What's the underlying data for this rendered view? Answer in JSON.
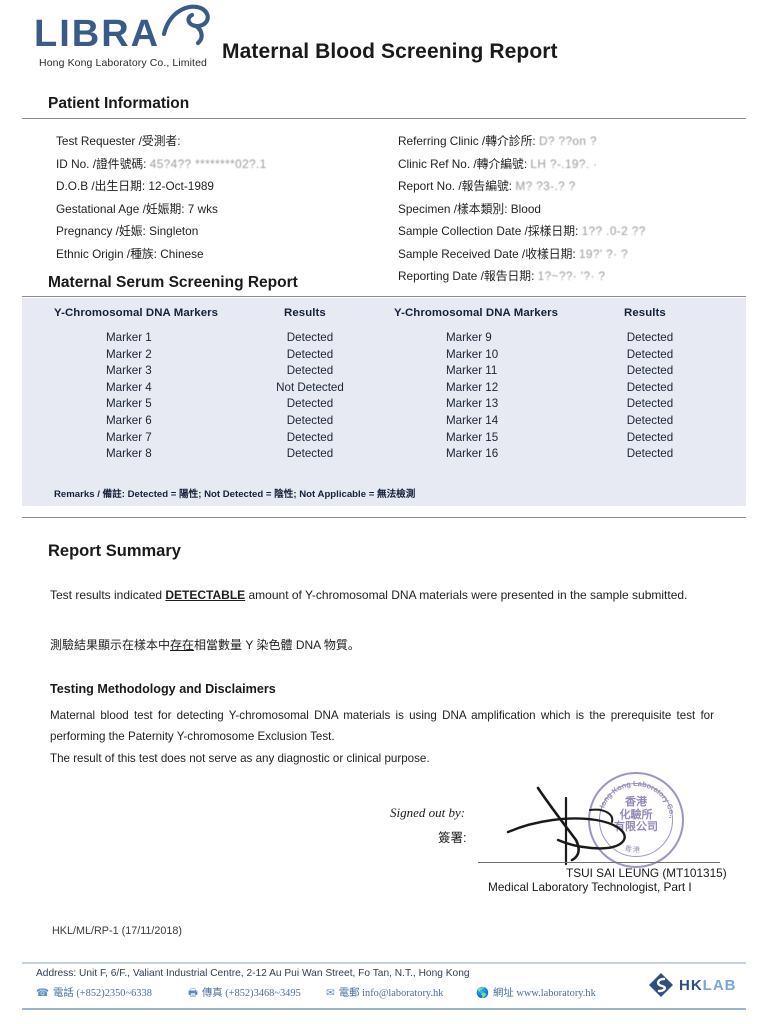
{
  "header": {
    "logo_word": "LIBRA",
    "logo_sub": "Hong Kong Laboratory Co., Limited",
    "title": "Maternal Blood Screening Report"
  },
  "patient_section": {
    "heading": "Patient Information",
    "left_fields": [
      {
        "label": "Test Requester /受測者:",
        "value": "",
        "faded": true
      },
      {
        "label": "ID No. /證件號碼:",
        "value": "45?4?? ********02?.1",
        "faded": true
      },
      {
        "label": "D.O.B /出生日期:",
        "value": "12-Oct-1989",
        "faded": false
      },
      {
        "label": "Gestational Age /妊娠期:",
        "value": "7 wks",
        "faded": false
      },
      {
        "label": "Pregnancy /妊娠:",
        "value": "Singleton",
        "faded": false
      },
      {
        "label": "Ethnic Origin /種族:",
        "value": "Chinese",
        "faded": false
      }
    ],
    "right_fields": [
      {
        "label": "Referring Clinic /轉介診所:",
        "value": "D? ??on  ?",
        "faded": true
      },
      {
        "label": "Clinic Ref No. /轉介編號:",
        "value": "LH  ?-.19?. ·",
        "faded": true
      },
      {
        "label": "Report No. /報告編號:",
        "value": "M? ?3-.?  ?",
        "faded": true
      },
      {
        "label": "Specimen /樣本類別:",
        "value": "Blood",
        "faded": false
      },
      {
        "label": "Sample Collection Date /採樣日期:",
        "value": "1?? .0-2 ??",
        "faded": true
      },
      {
        "label": "Sample Received Date /收樣日期:",
        "value": "19?'   ?· ?",
        "faded": true
      },
      {
        "label": "Reporting Date /報告日期:",
        "value": "1?~??· '?· ?",
        "faded": true
      }
    ]
  },
  "serum_section": {
    "heading": "Maternal Serum Screening Report",
    "columns": [
      "Y-Chromosomal DNA Markers",
      "Results"
    ],
    "left_rows": [
      {
        "marker": "Marker 1",
        "result": "Detected"
      },
      {
        "marker": "Marker 2",
        "result": "Detected"
      },
      {
        "marker": "Marker 3",
        "result": "Detected"
      },
      {
        "marker": "Marker 4",
        "result": "Not Detected"
      },
      {
        "marker": "Marker 5",
        "result": "Detected"
      },
      {
        "marker": "Marker 6",
        "result": "Detected"
      },
      {
        "marker": "Marker 7",
        "result": "Detected"
      },
      {
        "marker": "Marker 8",
        "result": "Detected"
      }
    ],
    "right_rows": [
      {
        "marker": "Marker 9",
        "result": "Detected"
      },
      {
        "marker": "Marker 10",
        "result": "Detected"
      },
      {
        "marker": "Marker 11",
        "result": "Detected"
      },
      {
        "marker": "Marker 12",
        "result": "Detected"
      },
      {
        "marker": "Marker 13",
        "result": "Detected"
      },
      {
        "marker": "Marker 14",
        "result": "Detected"
      },
      {
        "marker": "Marker 15",
        "result": "Detected"
      },
      {
        "marker": "Marker 16",
        "result": "Detected"
      }
    ],
    "remarks": "Remarks /  備註: Detected =  陽性; Not Detected =  陰性; Not Applicable =  無法檢測"
  },
  "summary_section": {
    "heading": "Report Summary",
    "line_a_pre": "Test results indicated ",
    "line_a_emph": "DETECTABLE",
    "line_a_post": " amount of Y-chromosomal DNA materials were presented in the sample submitted.",
    "line_chinese_pre": "測驗結果顯示在樣本中",
    "line_chinese_emph": "存在",
    "line_chinese_post": "相當數量 Y 染色體 DNA 物質。"
  },
  "methodology_section": {
    "heading": "Testing Methodology and Disclaimers",
    "paragraph": "Maternal blood test for detecting Y-chromosomal DNA materials is using DNA amplification which is the prerequisite test for performing the Paternity Y-chromosome Exclusion Test.",
    "disclaimer": "The result of this test does not serve as any diagnostic or clinical purpose."
  },
  "signature": {
    "signed_out_by": "Signed out by:",
    "signed_cn": "簽署:",
    "name": "TSUI SAI LEUNG (MT101315)",
    "role": "Medical Laboratory Technologist, Part I",
    "stamp_cn": "香港\n化驗所\n有限公司",
    "stamp_arc_top": "Hong Kong Laboratory Co., Limited",
    "stamp_color": "#7d6aa8"
  },
  "doc_code": "HKL/ML/RP-1 (17/11/2018)",
  "footer": {
    "address": "Address: Unit F, 6/F., Valiant Industrial Centre, 2-12 Au Pui Wan Street, Fo Tan, N.T., Hong Kong",
    "phone_label": "電話",
    "phone": "(+852)2350~6338",
    "fax_label": "傳真",
    "fax": "(+852)3468~3495",
    "email_label": "電郵",
    "email": "info@laboratory.hk",
    "web_label": "網址",
    "web": "www.laboratory.hk",
    "brand_dark": "HK",
    "brand_light": "LAB"
  }
}
